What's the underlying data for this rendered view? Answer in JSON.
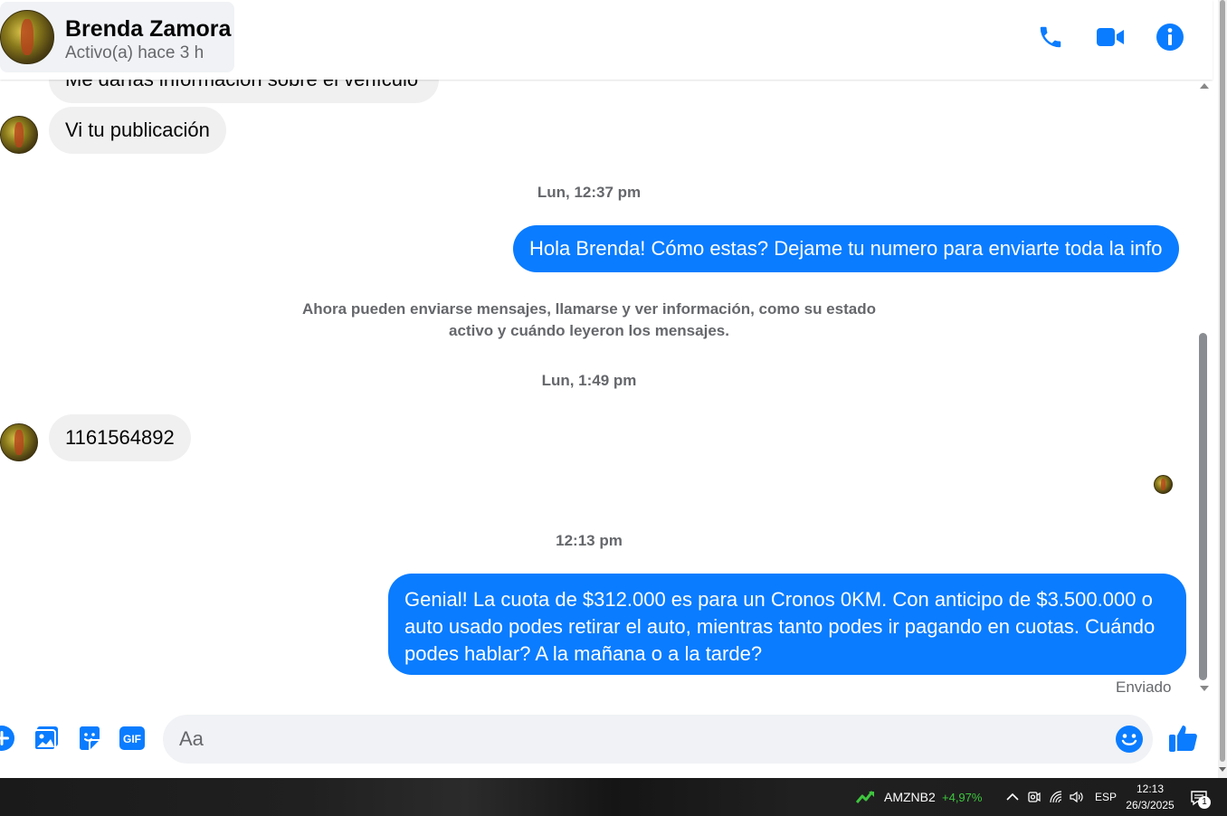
{
  "header": {
    "contact_name": "Brenda Zamora",
    "contact_status": "Activo(a) hace 3 h"
  },
  "messages": {
    "partial_incoming": "Me darías información sobre el vehículo",
    "incoming_1": "Vi tu publicación",
    "timestamp_1": "Lun, 12:37 pm",
    "outgoing_1": "Hola Brenda! Cómo estas? Dejame tu numero para enviarte toda la info",
    "notice": "Ahora pueden enviarse mensajes, llamarse y ver información, como su estado activo y cuándo leyeron los mensajes.",
    "timestamp_2": "Lun, 1:49 pm",
    "incoming_2": "1161564892",
    "timestamp_3": "12:13 pm",
    "outgoing_2": "Genial! La cuota de $312.000 es para un Cronos 0KM. Con anticipo de $3.500.000 o auto usado podes retirar el auto, mientras tanto podes ir pagando en cuotas. Cuándo podes hablar? A la mañana o a la tarde?",
    "sent_status": "Enviado"
  },
  "composer": {
    "placeholder": "Aa",
    "gif_label": "GIF"
  },
  "taskbar": {
    "stock_name": "AMZNB2",
    "stock_change": "+4,97%",
    "language": "ESP",
    "time": "12:13",
    "date": "26/3/2025",
    "notification_count": "1"
  },
  "colors": {
    "messenger_blue": "#0a7cff",
    "incoming_bubble": "#f0f0f0",
    "muted_text": "#65676b",
    "stock_green": "#3ec53e"
  }
}
